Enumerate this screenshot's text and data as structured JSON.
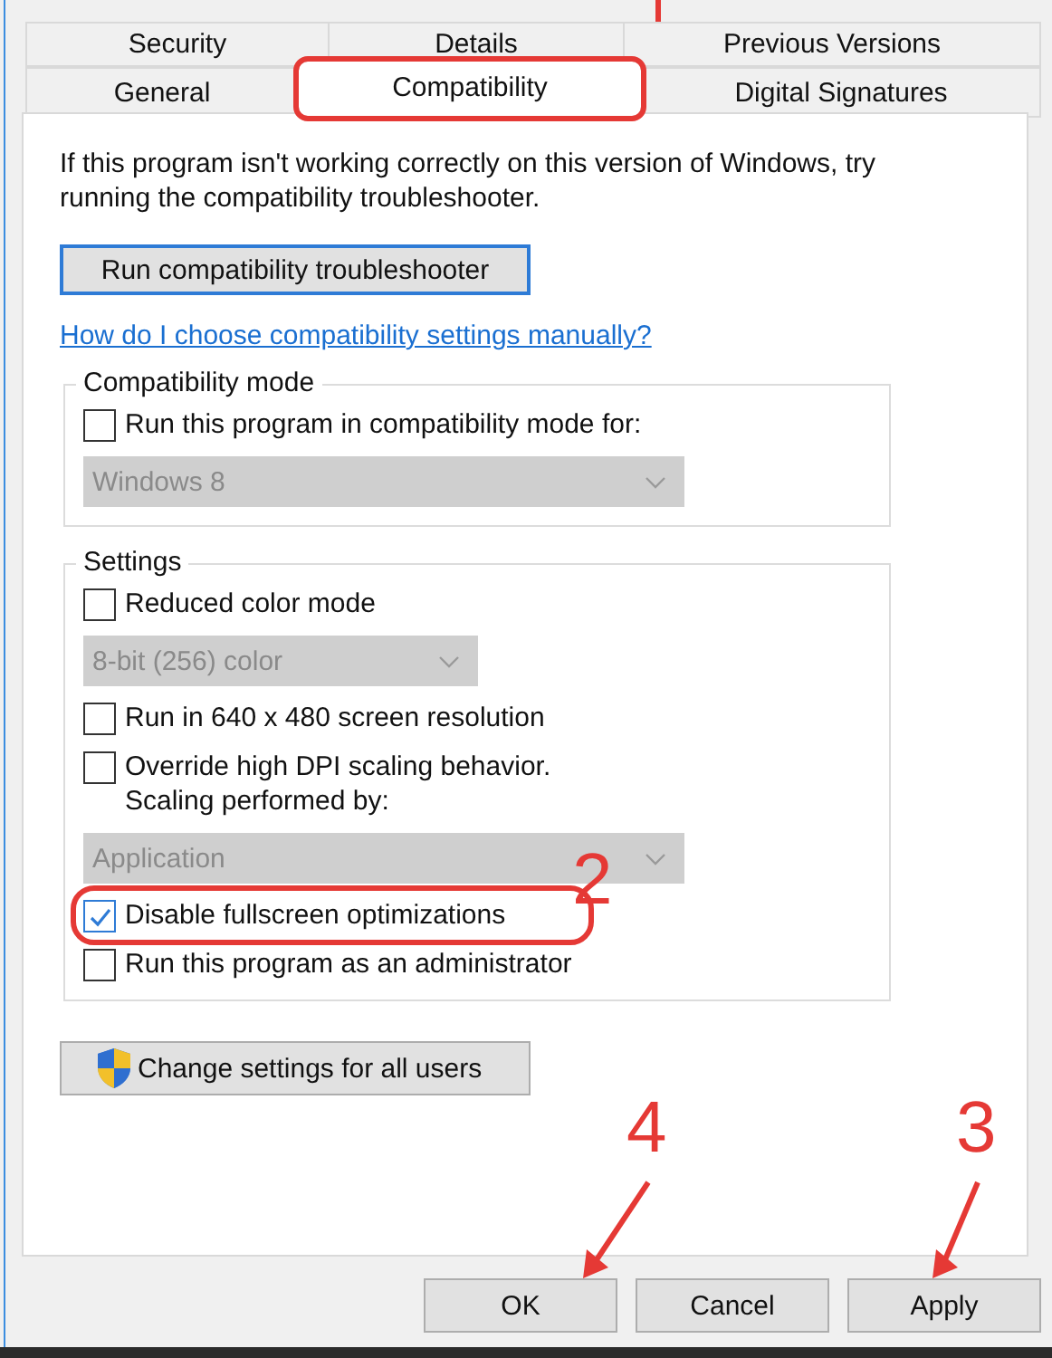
{
  "tabs": [
    [
      {
        "label": "Security",
        "selected": false,
        "highlighted": false
      },
      {
        "label": "Details",
        "selected": false,
        "highlighted": false
      },
      {
        "label": "Previous Versions",
        "selected": false,
        "highlighted": false
      }
    ],
    [
      {
        "label": "General",
        "selected": false,
        "highlighted": false
      },
      {
        "label": "Compatibility",
        "selected": true,
        "highlighted": true
      },
      {
        "label": "Digital Signatures",
        "selected": false,
        "highlighted": false
      }
    ]
  ],
  "intro": "If this program isn't working correctly on this version of Windows, try running the compatibility troubleshooter.",
  "troubleshooter_button": "Run compatibility troubleshooter",
  "help_link": "How do I choose compatibility settings manually?",
  "groups": [
    {
      "title": "Compatibility mode",
      "items": [
        {
          "kind": "checkbox",
          "label": "Run this program in compatibility mode for:",
          "checked": false,
          "highlighted": false
        },
        {
          "kind": "dropdown",
          "value": "Windows 8",
          "disabled": true
        }
      ]
    },
    {
      "title": "Settings",
      "items": [
        {
          "kind": "checkbox",
          "label": "Reduced color mode",
          "checked": false,
          "highlighted": false
        },
        {
          "kind": "dropdown",
          "value": "8-bit (256) color",
          "disabled": true
        },
        {
          "kind": "checkbox",
          "label": "Run in 640 x 480 screen resolution",
          "checked": false,
          "highlighted": false
        },
        {
          "kind": "checkbox",
          "label": "Override high DPI scaling behavior.\nScaling performed by:",
          "checked": false,
          "highlighted": false
        },
        {
          "kind": "dropdown",
          "value": "Application",
          "disabled": true
        },
        {
          "kind": "checkbox",
          "label": "Disable fullscreen optimizations",
          "checked": true,
          "highlighted": true
        },
        {
          "kind": "checkbox",
          "label": "Run this program as an administrator",
          "checked": false,
          "highlighted": false
        }
      ]
    }
  ],
  "all_users_button": "Change settings for all users",
  "buttons": [
    "OK",
    "Cancel",
    "Apply"
  ],
  "callouts": [
    {
      "label": "2",
      "arrow": false
    },
    {
      "label": "4",
      "arrow": true
    },
    {
      "label": "3",
      "arrow": true
    }
  ]
}
